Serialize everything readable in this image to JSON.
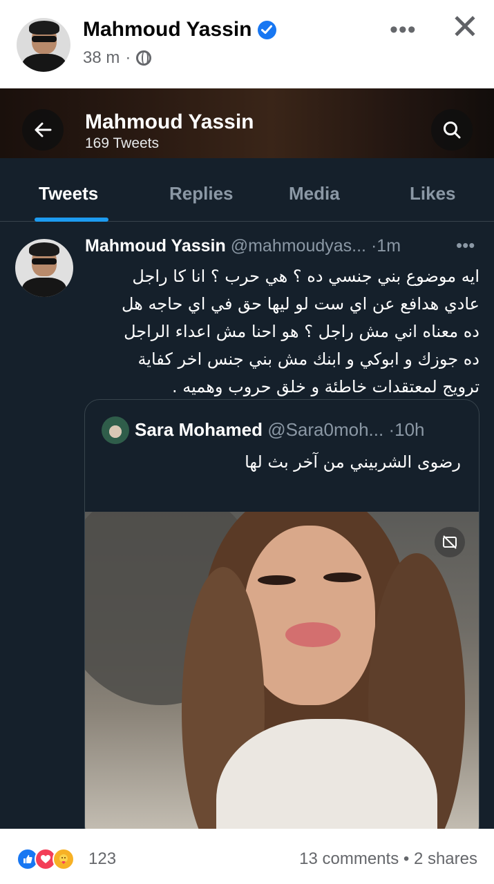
{
  "post": {
    "author_name": "Mahmoud Yassin",
    "time": "38 m",
    "separator": "·",
    "more_icon": "ellipsis-icon",
    "close_icon": "close-icon"
  },
  "twitter": {
    "profile_name": "Mahmoud Yassin",
    "tweet_count": "169 Tweets",
    "tabs": [
      {
        "label": "Tweets",
        "active": true
      },
      {
        "label": "Replies",
        "active": false
      },
      {
        "label": "Media",
        "active": false
      },
      {
        "label": "Likes",
        "active": false
      }
    ],
    "tweet": {
      "name": "Mahmoud Yassin",
      "handle": "@mahmoudyas...",
      "time": "·1m",
      "text_lines": [
        "ايه موضوع بني جنسي ده ؟ هي حرب ؟ انا كا راجل",
        "عادي هدافع عن اي ست لو ليها حق في اي حاجه هل",
        "ده معناه اني مش راجل ؟ هو احنا مش اعداء الراجل",
        "ده جوزك و ابوكي و ابنك مش بني جنس اخر كفاية",
        "ترويج لمعتقدات خاطئة و خلق حروب وهميه ."
      ]
    },
    "quoted": {
      "name": "Sara Mohamed",
      "handle": "@Sara0moh...",
      "time": "·10h",
      "text": "رضوى الشربيني من آخر بث لها"
    }
  },
  "footer": {
    "reaction_count": "123",
    "comments_shares": "13 comments • 2 shares"
  },
  "colors": {
    "twitter_bg": "#15202b",
    "accent_blue": "#1d9bf0",
    "facebook_blue": "#1877f2"
  }
}
